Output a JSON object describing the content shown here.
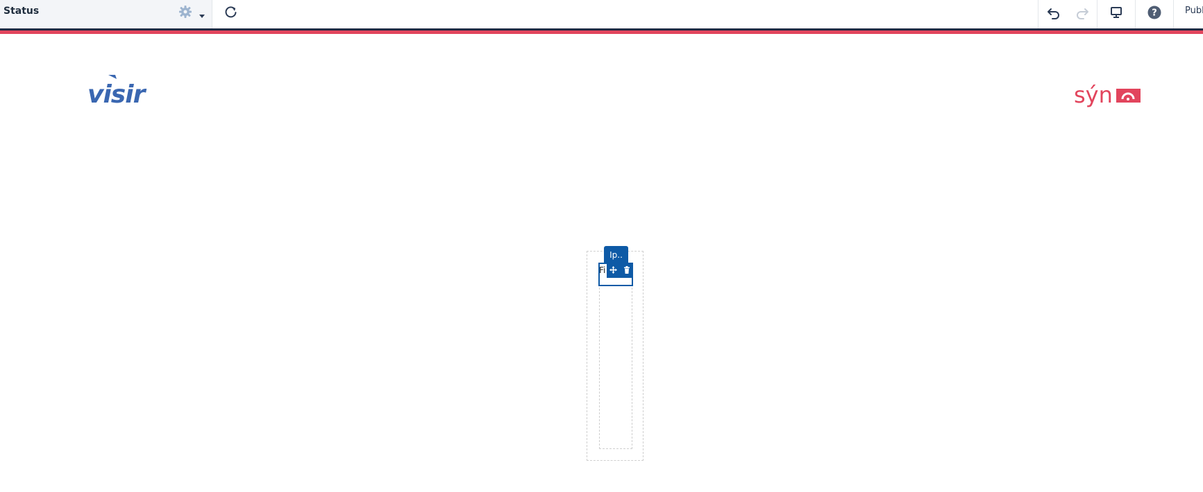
{
  "toolbar": {
    "title": "Status",
    "publish_label": "Publ",
    "icons": {
      "settings": "gear-icon",
      "dropdown": "chevron-down-icon",
      "refresh": "redo-circular-icon",
      "undo": "undo-icon",
      "redo": "redo-icon",
      "preview": "monitor-icon",
      "help": "help-icon"
    }
  },
  "page": {
    "logo_left": "visir",
    "logo_right": "sýn"
  },
  "editor": {
    "tag_label": "Ip..",
    "selected_text": "Fi",
    "tool_icons": [
      "move-icon",
      "trash-icon"
    ]
  },
  "colors": {
    "accent_blue": "#0e5aa6",
    "brand_red": "#e2455d",
    "navy": "#1d2a44",
    "visir_blue": "#3a67b1"
  }
}
